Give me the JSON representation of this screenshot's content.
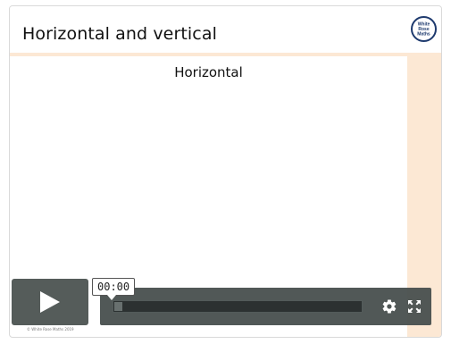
{
  "header": {
    "title": "Horizontal and vertical",
    "logo_lines": [
      "White",
      "Rose",
      "Maths"
    ]
  },
  "slide": {
    "heading": "Horizontal"
  },
  "player": {
    "current_time": "00:00",
    "progress": 0,
    "copyright": "© White Rose Maths 2019",
    "icons": {
      "play": "play-icon",
      "settings": "gear-icon",
      "fullscreen": "fullscreen-icon"
    }
  },
  "colors": {
    "accent_strip": "#fce8d4",
    "logo_ring": "#1e3a6e",
    "controls_bg": "#464e4c"
  }
}
